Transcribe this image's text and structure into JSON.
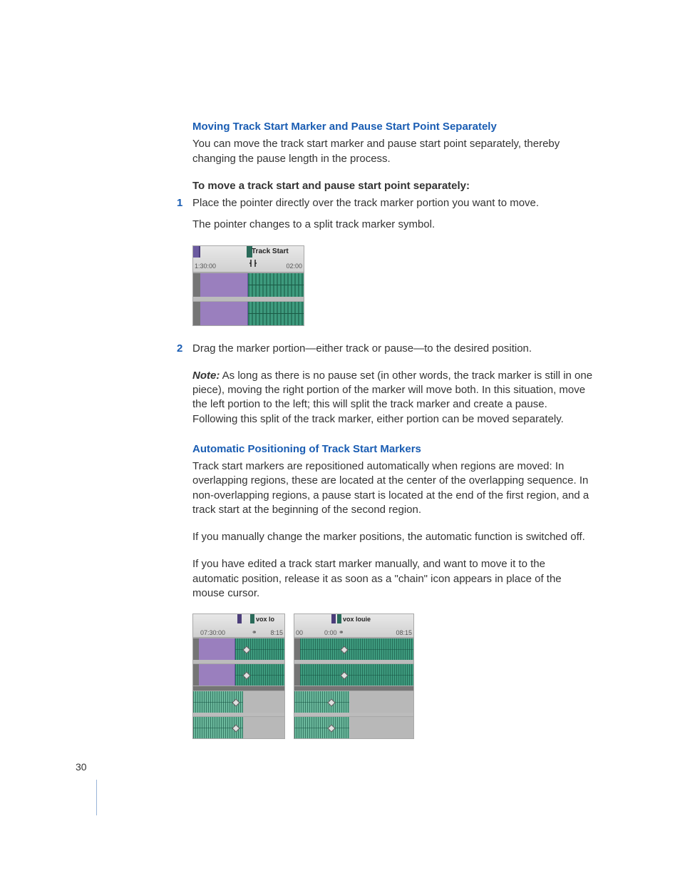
{
  "section1": {
    "heading": "Moving Track Start Marker and Pause Start Point Separately",
    "intro": "You can move the track start marker and pause start point separately, thereby changing the pause length in the process.",
    "procedure_title": "To move a track start and pause start point separately:",
    "step1_num": "1",
    "step1": "Place the pointer directly over the track marker portion you want to move.",
    "step1_result": "The pointer changes to a split track marker symbol.",
    "step2_num": "2",
    "step2": "Drag the marker portion—either track or pause—to the desired position.",
    "note_label": "Note:",
    "note": "  As long as there is no pause set (in other words, the track marker is still in one piece), moving the right portion of the marker will move both. In this situation, move the left portion to the left; this will split the track marker and create a pause. Following this split of the track marker, either portion can be moved separately."
  },
  "section2": {
    "heading": "Automatic Positioning of Track Start Markers",
    "p1": "Track start markers are repositioned automatically when regions are moved:  In overlapping regions, these are located at the center of the overlapping sequence. In non-overlapping regions, a pause start is located at the end of the first region, and a track start at the beginning of the second region.",
    "p2": "If you manually change the marker positions, the automatic function is switched off.",
    "p3": "If you have edited a track start marker manually, and want to move it to the automatic position, release it as soon as a \"chain\" icon appears in place of the mouse cursor."
  },
  "figure1": {
    "track_start_label": "Track Start",
    "time_left": "1:30:00",
    "time_right": "02:00"
  },
  "figureA": {
    "label": "vox lo",
    "time_left": "07:30:00",
    "time_right": "8:15",
    "chain_icon": "⚭"
  },
  "figureB": {
    "label": "vox louie",
    "time_00": "00",
    "time_mid": "0:00",
    "time_right": "08:15",
    "chain_icon": "⚭"
  },
  "page_number": "30"
}
